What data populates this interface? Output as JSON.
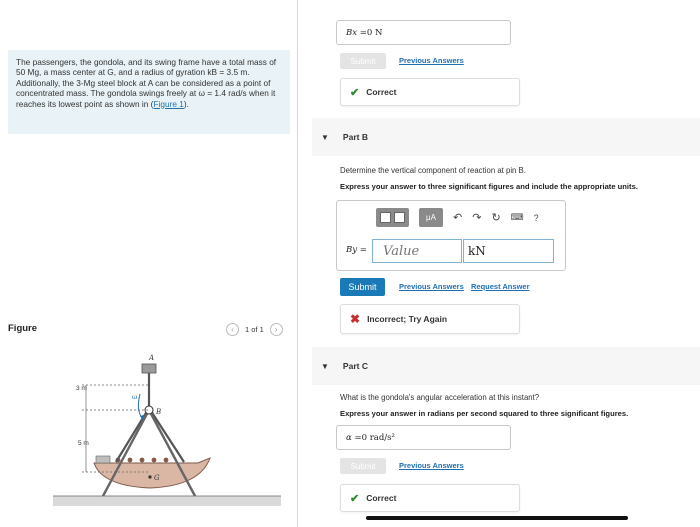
{
  "problem": {
    "text": "The passengers, the gondola, and its swing frame have a total mass of 50 Mg, a mass center at G, and a radius of gyration kB = 3.5 m. Additionally, the 3-Mg steel block at A can be considered as a point of concentrated mass. The gondola swings freely at ω = 1.4 rad/s when it reaches its lowest point as shown in (",
    "figure_link": "Figure 1",
    "text_end": ")."
  },
  "figure": {
    "title": "Figure",
    "pager": "1 of 1",
    "labels": {
      "a": "A",
      "b": "B",
      "g": "G",
      "dim1": "3 m",
      "dim2": "5 m",
      "omega": "ω"
    }
  },
  "part_a": {
    "answer_label": "Bx = ",
    "answer_value": "0 N",
    "submit_label": "Submit",
    "previous_answers": "Previous Answers",
    "feedback": "Correct"
  },
  "part_b": {
    "title": "Part B",
    "question": "Determine the vertical component of reaction at pin B.",
    "instruction": "Express your answer to three significant figures and include the appropriate units.",
    "mu_label": "μA",
    "help_label": "?",
    "var_label": "By = ",
    "value_placeholder": "Value",
    "unit_value": "kN",
    "submit_label": "Submit",
    "previous_answers": "Previous Answers",
    "request_answer": "Request Answer",
    "feedback": "Incorrect; Try Again"
  },
  "part_c": {
    "title": "Part C",
    "question": "What is the gondola's angular acceleration at this instant?",
    "instruction": "Express your answer in radians per second squared to three significant figures.",
    "answer_label": "α = ",
    "answer_value": "0 rad/s²",
    "submit_label": "Submit",
    "previous_answers": "Previous Answers",
    "feedback": "Correct"
  },
  "colors": {
    "accent": "#1a7ab8",
    "correct": "#2f8a2f",
    "incorrect": "#c62f2f",
    "info_bg": "#e9f3f7"
  }
}
